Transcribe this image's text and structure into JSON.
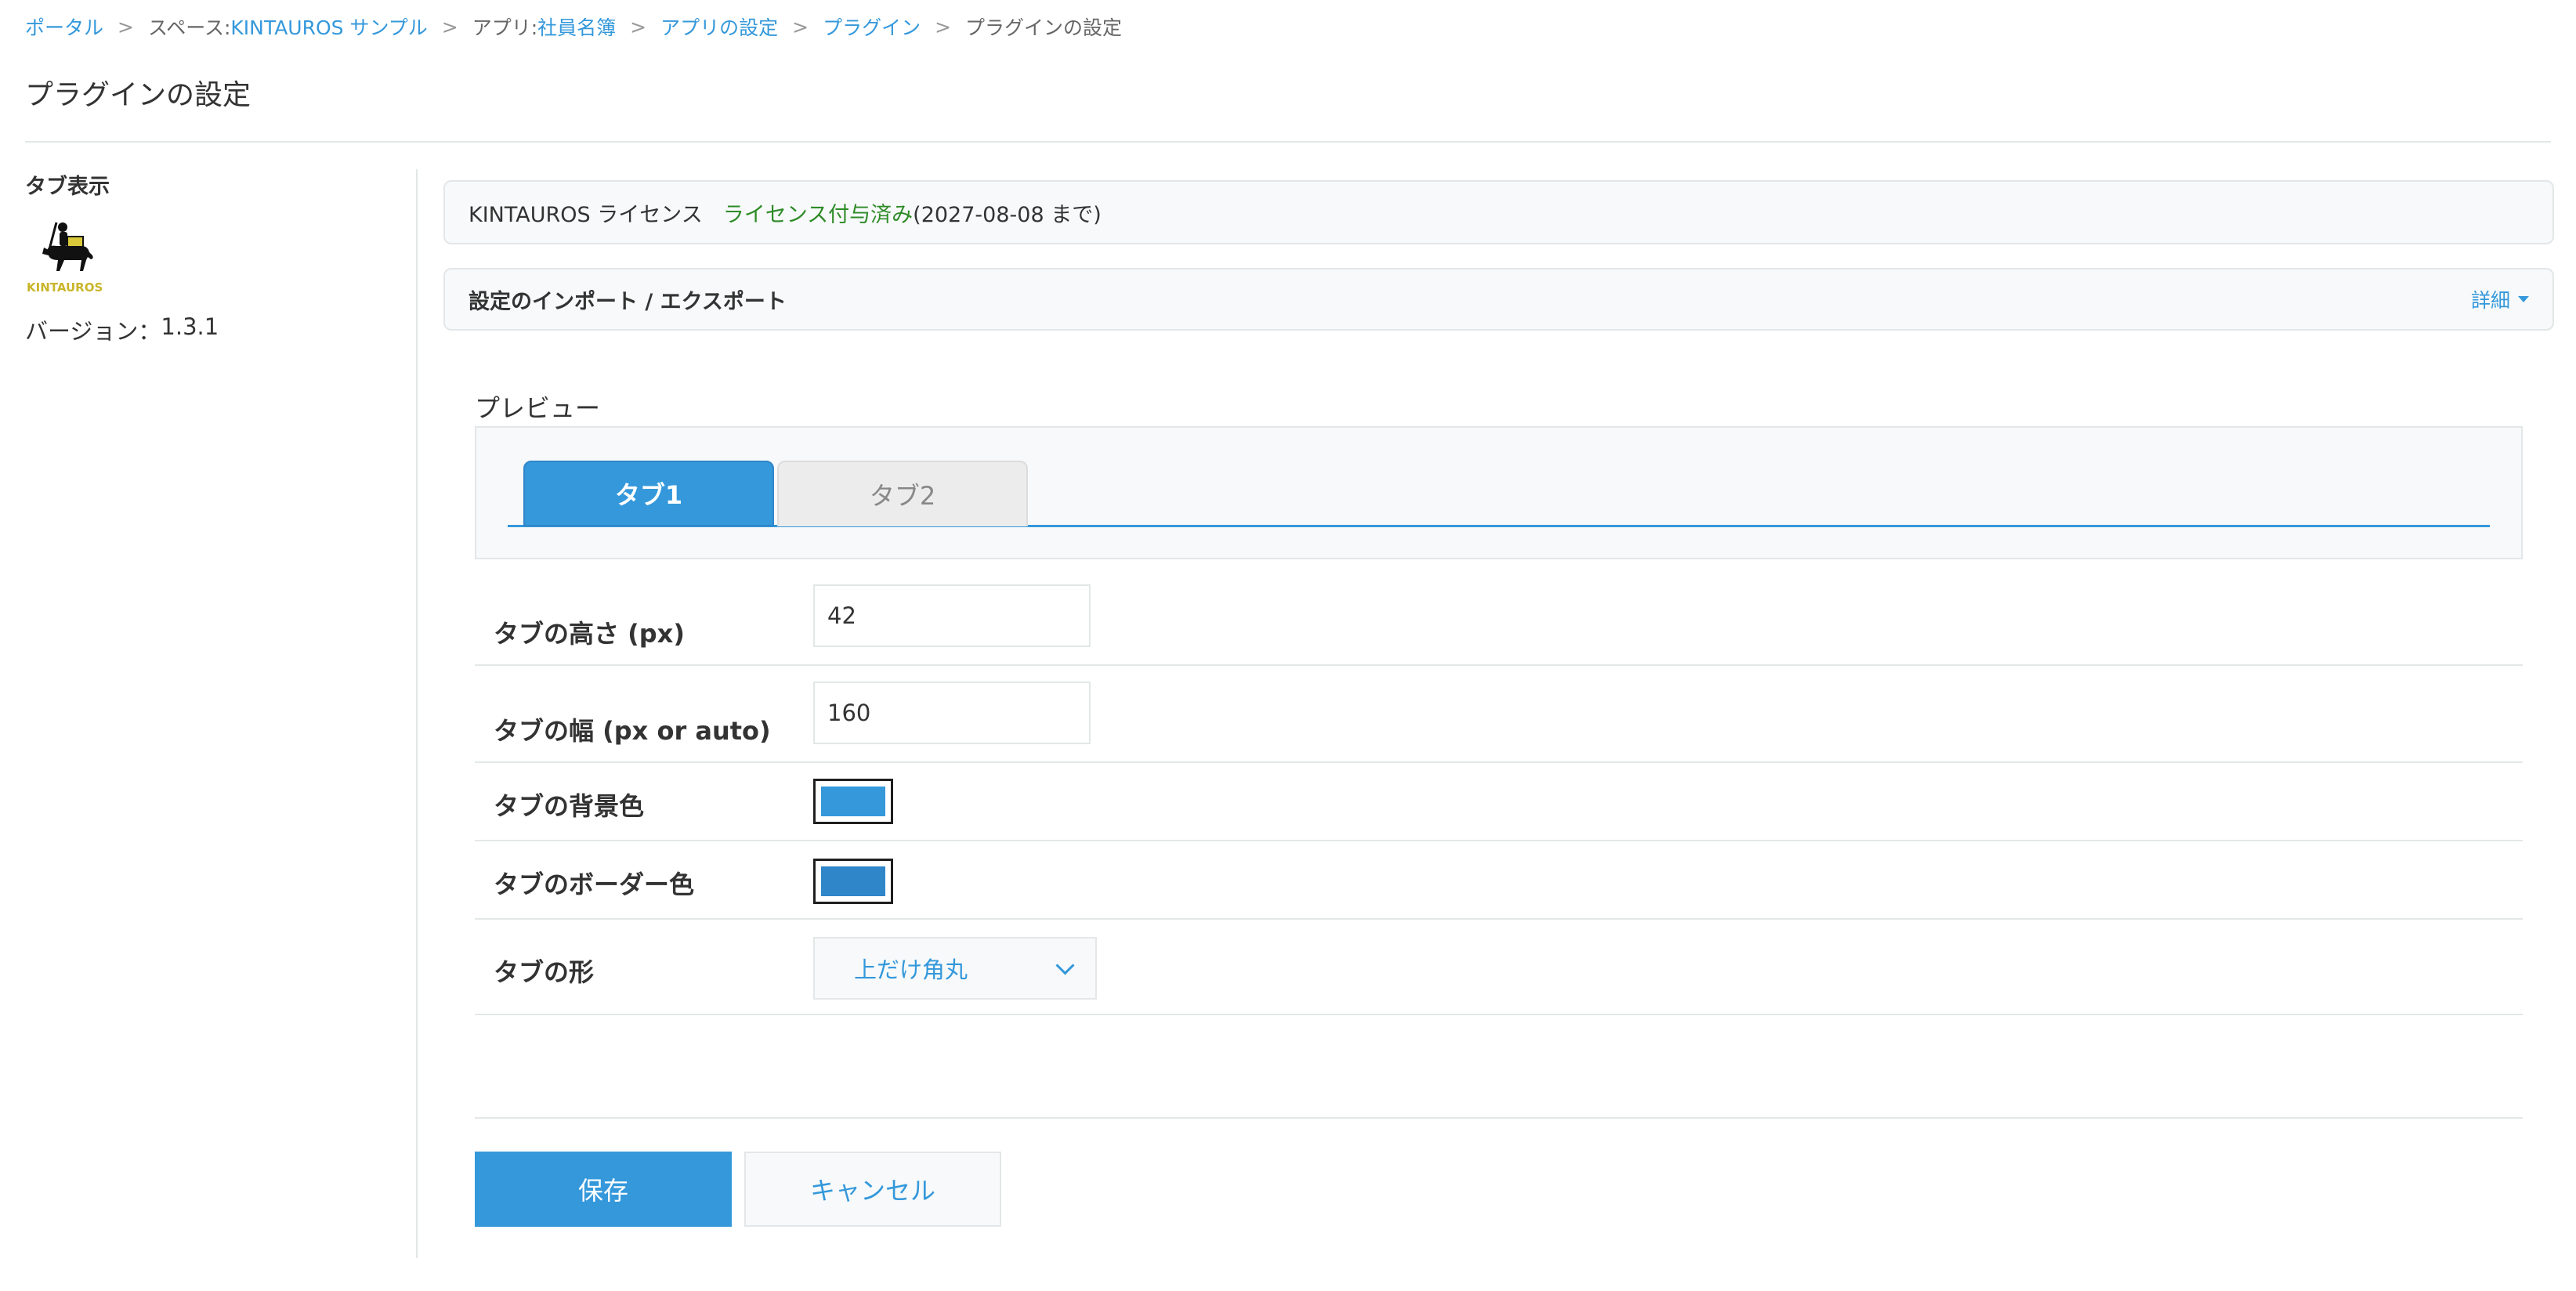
{
  "breadcrumb": {
    "portal": "ポータル",
    "space_prefix": "スペース: ",
    "space_name": "KINTAUROS サンプル",
    "app_prefix": "アプリ: ",
    "app_name": "社員名簿",
    "app_settings": "アプリの設定",
    "plugins": "プラグイン",
    "current": "プラグインの設定",
    "separator": ">"
  },
  "page": {
    "title": "プラグインの設定"
  },
  "sidebar": {
    "plugin_name": "タブ表示",
    "logo_text": "KINTAUROS",
    "version_label": "バージョン：",
    "version_value": "1.3.1"
  },
  "license": {
    "product": "KINTAUROS ライセンス",
    "status": "ライセンス付与済み",
    "until": "(2027-08-08 まで)"
  },
  "import_export": {
    "title": "設定のインポート / エクスポート",
    "detail_label": "詳細"
  },
  "preview": {
    "label": "プレビュー",
    "tabs": [
      "タブ1",
      "タブ2"
    ]
  },
  "settings": {
    "height": {
      "label": "タブの高さ (px)",
      "value": "42"
    },
    "width": {
      "label": "タブの幅 (px or auto)",
      "value": "160"
    },
    "bg_color": {
      "label": "タブの背景色",
      "value": "#3498db"
    },
    "border_color": {
      "label": "タブのボーダー色",
      "value": "#2f86c9"
    },
    "shape": {
      "label": "タブの形",
      "value": "上だけ角丸"
    }
  },
  "buttons": {
    "save": "保存",
    "cancel": "キャンセル"
  },
  "colors": {
    "accent": "#3498db",
    "license_ok": "#2e8b27",
    "border": "#e3e7e8"
  }
}
